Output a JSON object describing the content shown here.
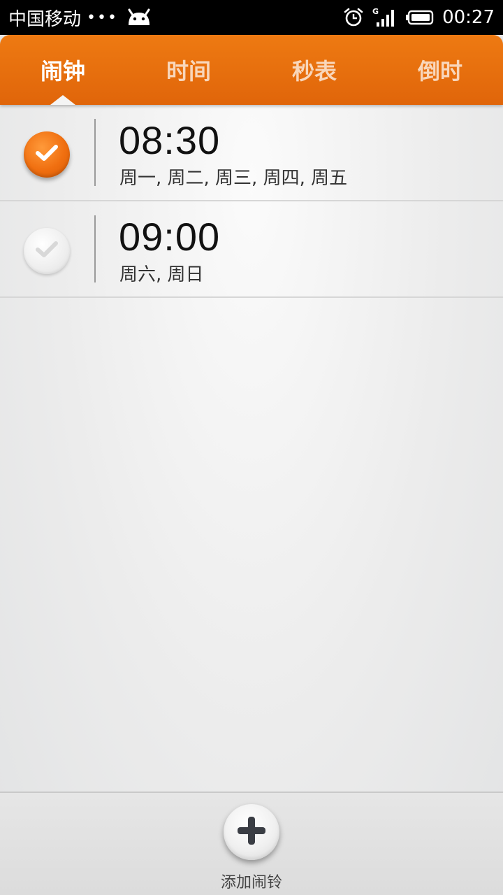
{
  "status_bar": {
    "carrier": "中国移动",
    "dots": "•••",
    "time": "00:27",
    "icons": [
      "android-icon",
      "alarm-clock-icon",
      "signal-g-icon",
      "battery-icon"
    ]
  },
  "tabs": [
    {
      "label": "闹钟",
      "active": true
    },
    {
      "label": "时间",
      "active": false
    },
    {
      "label": "秒表",
      "active": false
    },
    {
      "label": "倒时",
      "active": false
    }
  ],
  "alarms": [
    {
      "time": "08:30",
      "days": "周一, 周二, 周三, 周四, 周五",
      "enabled": true
    },
    {
      "time": "09:00",
      "days": "周六, 周日",
      "enabled": false
    }
  ],
  "bottom": {
    "add_label": "添加闹铃"
  },
  "colors": {
    "accent": "#e8690c",
    "status_bar": "#000000"
  }
}
